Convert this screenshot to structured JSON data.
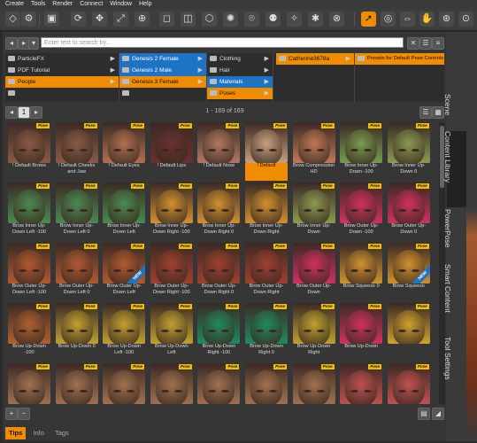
{
  "menu": [
    "Create",
    "Tools",
    "Render",
    "Connect",
    "Window",
    "Help"
  ],
  "search": {
    "placeholder": "Enter text to search by..."
  },
  "browser": {
    "col1": [
      {
        "label": "ParticleFX"
      },
      {
        "label": "PDF Tutorial"
      },
      {
        "label": "People"
      },
      {
        "label": ""
      }
    ],
    "col2": [
      {
        "label": "Genesis 2 Female"
      },
      {
        "label": "Genesis 2 Male"
      },
      {
        "label": "Genesis 3 Female"
      },
      {
        "label": ""
      }
    ],
    "col3": [
      {
        "label": "Clothing"
      },
      {
        "label": "Hair"
      },
      {
        "label": "Materials"
      },
      {
        "label": "Poses"
      }
    ],
    "col4": [
      {
        "label": "Catherine3678a"
      }
    ],
    "col5": [
      {
        "label": "Presets for Default Pose Controls"
      }
    ]
  },
  "pager": {
    "page": "1",
    "count": "1 - 169 of 169"
  },
  "tiles": [
    {
      "label": "! Default Brows"
    },
    {
      "label": "! Default Cheeks and Jaw"
    },
    {
      "label": "! Default Eyes"
    },
    {
      "label": "! Default Lips"
    },
    {
      "label": "! Default Nose"
    },
    {
      "label": "! Default"
    },
    {
      "label": "Brow Compression HD"
    },
    {
      "label": "Brow Inner Up-Down -100"
    },
    {
      "label": "Brow Inner Up-Down 0"
    },
    {
      "label": "Brow Inner Up-Down Left -100"
    },
    {
      "label": "Brow Inner Up-Down Left 0"
    },
    {
      "label": "Brow Inner Up-Down Left"
    },
    {
      "label": "Brow Inner Up-Down Right -100"
    },
    {
      "label": "Brow Inner Up-Down Right 0"
    },
    {
      "label": "Brow Inner Up-Down Right"
    },
    {
      "label": "Brow Inner Up-Down"
    },
    {
      "label": "Brow Outer Up-Down -100"
    },
    {
      "label": "Brow Outer Up-Down 0"
    },
    {
      "label": "Brow Outer Up-Down Left -100"
    },
    {
      "label": "Brow Outer Up-Down Left 0"
    },
    {
      "label": "Brow Outer Up-Down Left"
    },
    {
      "label": "Brow Outer Up-Down Right -100"
    },
    {
      "label": "Brow Outer Up-Down Right 0"
    },
    {
      "label": "Brow Outer Up-Down Right"
    },
    {
      "label": "Brow Outer Up-Down"
    },
    {
      "label": "Brow Squeeze 0"
    },
    {
      "label": "Brow Squeeze"
    },
    {
      "label": "Brow Up-Down -100"
    },
    {
      "label": "Brow Up-Down 0"
    },
    {
      "label": "Brow Up-Down Left -100"
    },
    {
      "label": "Brow Up-Down Left"
    },
    {
      "label": "Brow Up-Down Right -100"
    },
    {
      "label": "Brow Up-Down Right 0"
    },
    {
      "label": "Brow Up-Down Right"
    },
    {
      "label": "Brow Up-Down"
    },
    {
      "label": ""
    },
    {
      "label": ""
    },
    {
      "label": ""
    },
    {
      "label": ""
    },
    {
      "label": ""
    },
    {
      "label": ""
    },
    {
      "label": ""
    },
    {
      "label": ""
    },
    {
      "label": ""
    },
    {
      "label": ""
    }
  ],
  "tile_colors": [
    "#8a5a45",
    "#8a5a45",
    "#b07050",
    "#6a3030",
    "#b07860",
    "#c8a080",
    "#c07858",
    "#7a9a50",
    "#8a9a50",
    "#4a8a50",
    "#4a8a50",
    "#4a8a50",
    "#d09030",
    "#d09030",
    "#d09030",
    "#8a9a50",
    "#d03060",
    "#d03060",
    "#b05a30",
    "#b05a30",
    "#b05a30",
    "#a04030",
    "#a04030",
    "#a04030",
    "#d03060",
    "#d09030",
    "#d09030",
    "#b06030",
    "#c0a030",
    "#c0a030",
    "#c0a030",
    "#208a60",
    "#208a60",
    "#c0a030",
    "#d03060",
    "#d0a030",
    "#a07050",
    "#a07050",
    "#a07050",
    "#a07050",
    "#a07050",
    "#a07050",
    "#a07050",
    "#c05050",
    "#c05050"
  ],
  "badge_text": "Pose",
  "new_text": "NEW",
  "new_tiles": [
    20,
    26
  ],
  "selected_tile": 5,
  "bottom_tabs": [
    "Tips",
    "Info",
    "Tags"
  ],
  "side_tabs": [
    "Scene",
    "Content Library",
    "PowerPose",
    "Smart Content",
    "Tool Settings"
  ]
}
